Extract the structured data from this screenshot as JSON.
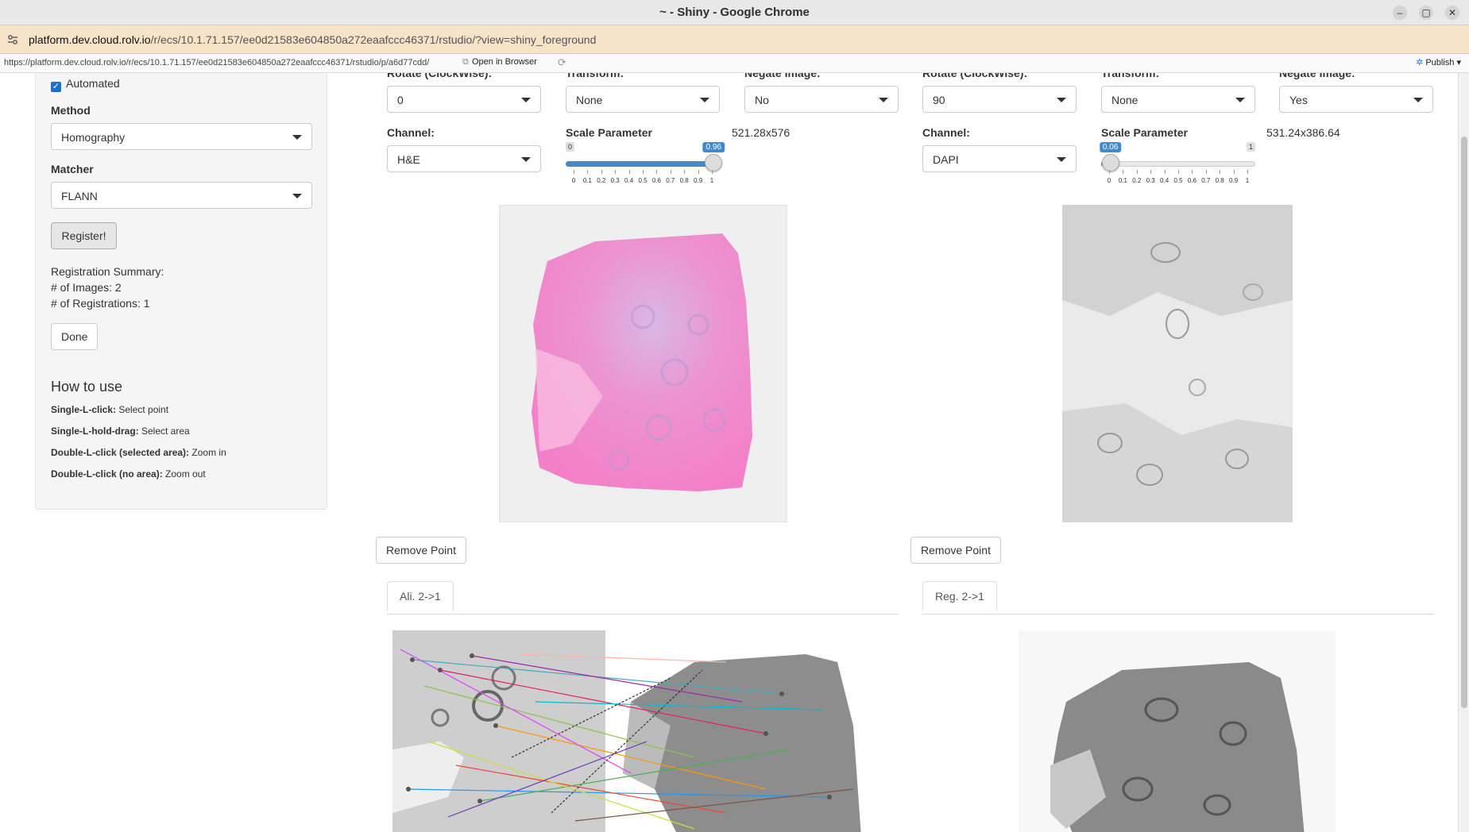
{
  "browser": {
    "window_title": "~ - Shiny - Google Chrome",
    "url_host": "platform.dev.cloud.rolv.io",
    "url_path": "/r/ecs/10.1.71.157/ee0d21583e604850a272eaafccc46371/rstudio/?view=shiny_foreground",
    "win_min": "–",
    "win_max": "▢",
    "win_close": "✕"
  },
  "rstudio_bar": {
    "url": "https://platform.dev.cloud.rolv.io/r/ecs/10.1.71.157/ee0d21583e604850a272eaafccc46371/rstudio/p/a6d77cdd/",
    "open_in_browser": "Open in Browser",
    "publish": "Publish"
  },
  "sidebar": {
    "automated_label": "Automated",
    "automated_checked": true,
    "method_label": "Method",
    "method_value": "Homography",
    "matcher_label": "Matcher",
    "matcher_value": "FLANN",
    "register_button": "Register!",
    "summary_title": "Registration Summary:",
    "summary_images": "# of Images: 2",
    "summary_registrations": "# of Registrations: 1",
    "done_button": "Done",
    "howto_title": "How to use",
    "howto": [
      {
        "key": "Single-L-click:",
        "desc": "Select point"
      },
      {
        "key": "Single-L-hold-drag:",
        "desc": "Select area"
      },
      {
        "key": "Double-L-click (selected area):",
        "desc": "Zoom in"
      },
      {
        "key": "Double-L-click (no area):",
        "desc": "Zoom out"
      }
    ]
  },
  "left_panel": {
    "rotate_label": "Rotate (ClockWise):",
    "rotate_value": "0",
    "transform_label": "Transform:",
    "transform_value": "None",
    "negate_label": "Negate Image:",
    "negate_value": "No",
    "channel_label": "Channel:",
    "channel_value": "H&E",
    "scale_label": "Scale Parameter",
    "scale_min": "0",
    "scale_max": "1",
    "scale_value": "0.96",
    "scale_value_num": 0.96,
    "dims": "521.28x576",
    "remove_point": "Remove Point",
    "tab_label": "Ali. 2->1"
  },
  "right_panel": {
    "rotate_label": "Rotate (ClockWise):",
    "rotate_value": "90",
    "transform_label": "Transform:",
    "transform_value": "None",
    "negate_label": "Negate Image:",
    "negate_value": "Yes",
    "channel_label": "Channel:",
    "channel_value": "DAPI",
    "scale_label": "Scale Parameter",
    "scale_min": "0",
    "scale_max": "1",
    "scale_value": "0.06",
    "scale_value_num": 0.06,
    "dims": "531.24x386.64",
    "remove_point": "Remove Point",
    "tab_label": "Reg. 2->1"
  },
  "slider_ticks": [
    "0",
    "0.1",
    "0.2",
    "0.3",
    "0.4",
    "0.5",
    "0.6",
    "0.7",
    "0.8",
    "0.9",
    "1"
  ],
  "colors": {
    "accent": "#428bca",
    "checkbox": "#1f6fd1",
    "urlbar": "#f6e3c8",
    "he_stain": "#f08ccf"
  }
}
